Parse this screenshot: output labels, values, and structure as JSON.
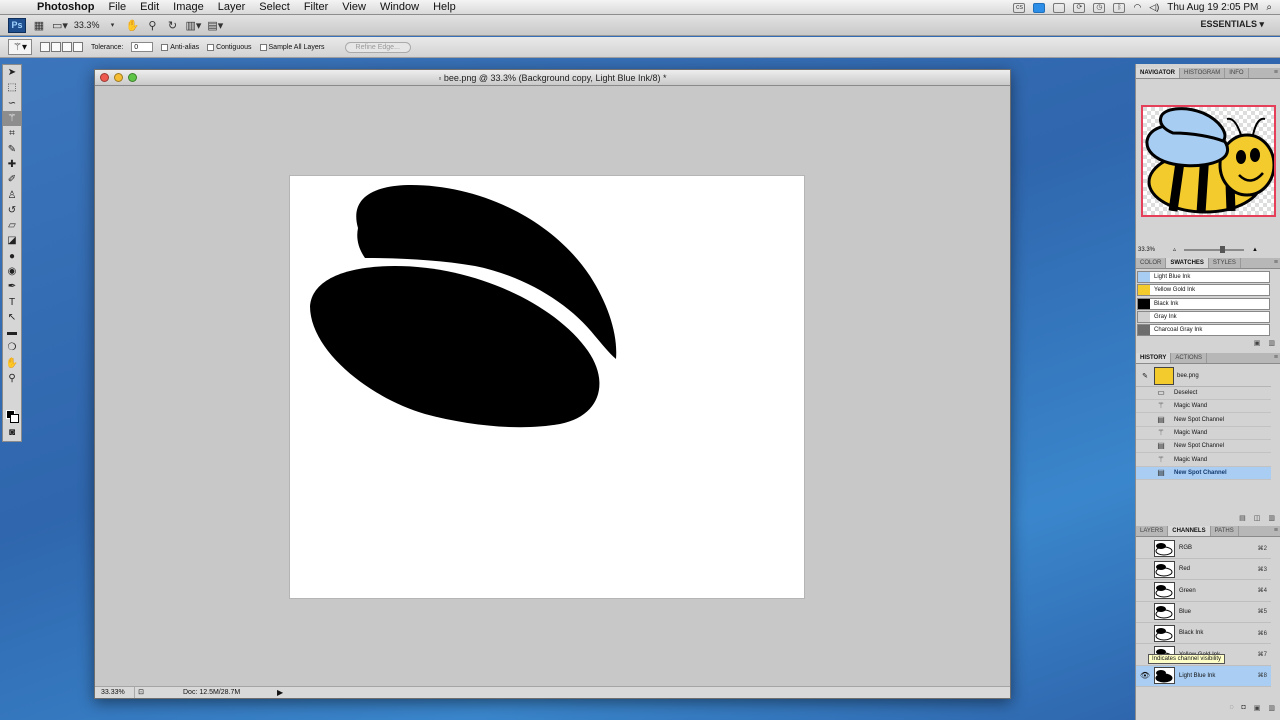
{
  "menubar": {
    "app_name": "Photoshop",
    "items": [
      "File",
      "Edit",
      "Image",
      "Layer",
      "Select",
      "Filter",
      "View",
      "Window",
      "Help"
    ],
    "clock": "Thu Aug 19  2:05 PM"
  },
  "appbar": {
    "logo": "Ps",
    "zoom": "33.3%",
    "workspace": "ESSENTIALS ▾"
  },
  "options": {
    "tolerance_label": "Tolerance:",
    "tolerance_value": "0",
    "anti_alias": "Anti-alias",
    "contiguous": "Contiguous",
    "sample_all": "Sample All Layers",
    "refine_edge": "Refine Edge..."
  },
  "document": {
    "title": "bee.png @ 33.3% (Background copy, Light Blue Ink/8) *",
    "status_zoom": "33.33%",
    "status_doc": "Doc: 12.5M/28.7M"
  },
  "navigator": {
    "tabs": [
      "NAVIGATOR",
      "HISTOGRAM",
      "INFO"
    ],
    "zoom": "33.3%"
  },
  "swatches": {
    "tabs": [
      "COLOR",
      "SWATCHES",
      "STYLES"
    ],
    "items": [
      {
        "name": "Light Blue Ink",
        "color": "#a7cdf2"
      },
      {
        "name": "Yellow Gold Ink",
        "color": "#f3cb2c"
      },
      {
        "name": "Black Ink",
        "color": "#000000"
      },
      {
        "name": "Gray Ink",
        "color": "#cfcfcf"
      },
      {
        "name": "Charcoal Gray Ink",
        "color": "#6d6d6d"
      }
    ]
  },
  "history": {
    "tabs": [
      "HISTORY",
      "ACTIONS"
    ],
    "snapshot": "bee.png",
    "steps": [
      "Deselect",
      "Magic Wand",
      "New Spot Channel",
      "Magic Wand",
      "New Spot Channel",
      "Magic Wand",
      "New Spot Channel"
    ]
  },
  "channels": {
    "tabs": [
      "LAYERS",
      "CHANNELS",
      "PATHS"
    ],
    "rows": [
      {
        "name": "RGB",
        "key": "⌘2"
      },
      {
        "name": "Red",
        "key": "⌘3"
      },
      {
        "name": "Green",
        "key": "⌘4"
      },
      {
        "name": "Blue",
        "key": "⌘5"
      },
      {
        "name": "Black Ink",
        "key": "⌘6"
      },
      {
        "name": "Yellow Gold Ink",
        "key": "⌘7"
      },
      {
        "name": "Light Blue Ink",
        "key": "⌘8"
      }
    ],
    "tooltip": "Indicates channel visibility"
  },
  "colors": {
    "desktop": "#3a78bf",
    "selection": "#a9cdf3",
    "nav_border": "#e63f5a"
  }
}
